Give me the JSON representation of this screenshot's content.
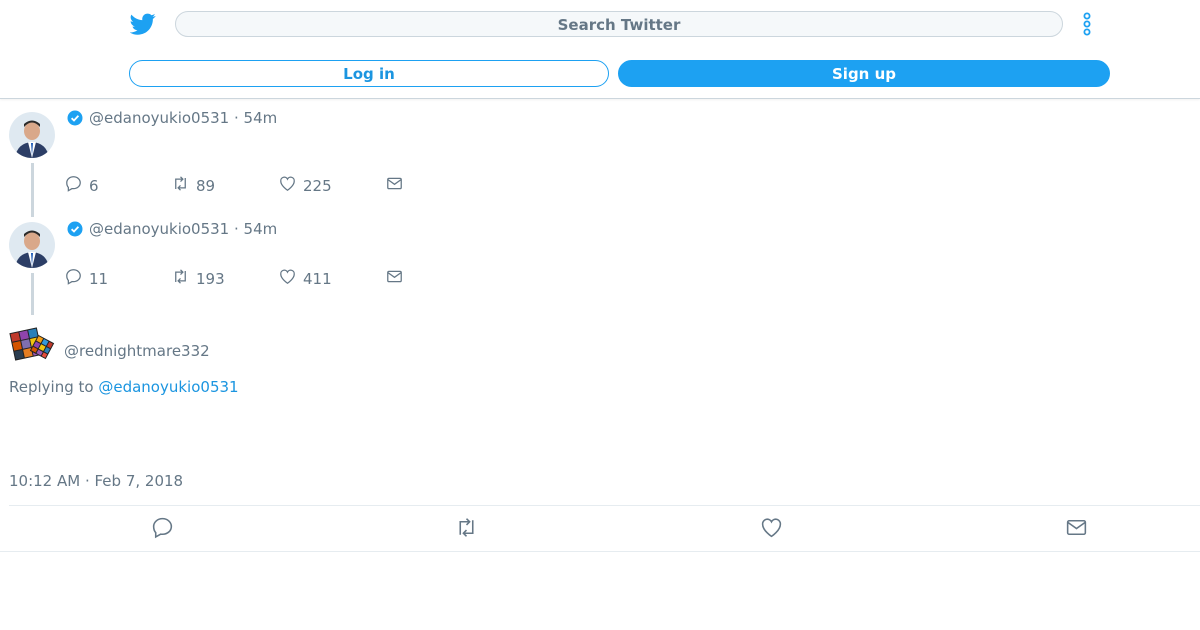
{
  "header": {
    "search_placeholder": "Search Twitter",
    "login_label": "Log in",
    "signup_label": "Sign up"
  },
  "thread": [
    {
      "handle": "@edanoyukio0531",
      "time": "· 54m",
      "replies": "6",
      "retweets": "89",
      "likes": "225"
    },
    {
      "handle": "@edanoyukio0531",
      "time": "· 54m",
      "replies": "11",
      "retweets": "193",
      "likes": "411"
    }
  ],
  "main_tweet": {
    "handle": "@rednightmare332",
    "replying_prefix": "Replying to",
    "replying_to": "@edanoyukio0531",
    "timestamp": "10:12 AM · Feb 7, 2018"
  },
  "colors": {
    "brand": "#1da1f2",
    "link": "#1b95e0",
    "text_secondary": "#657786"
  },
  "icons": [
    "twitter-logo-icon",
    "more-vertical-icon",
    "verified-badge-icon",
    "reply-icon",
    "retweet-icon",
    "like-icon",
    "message-icon"
  ]
}
